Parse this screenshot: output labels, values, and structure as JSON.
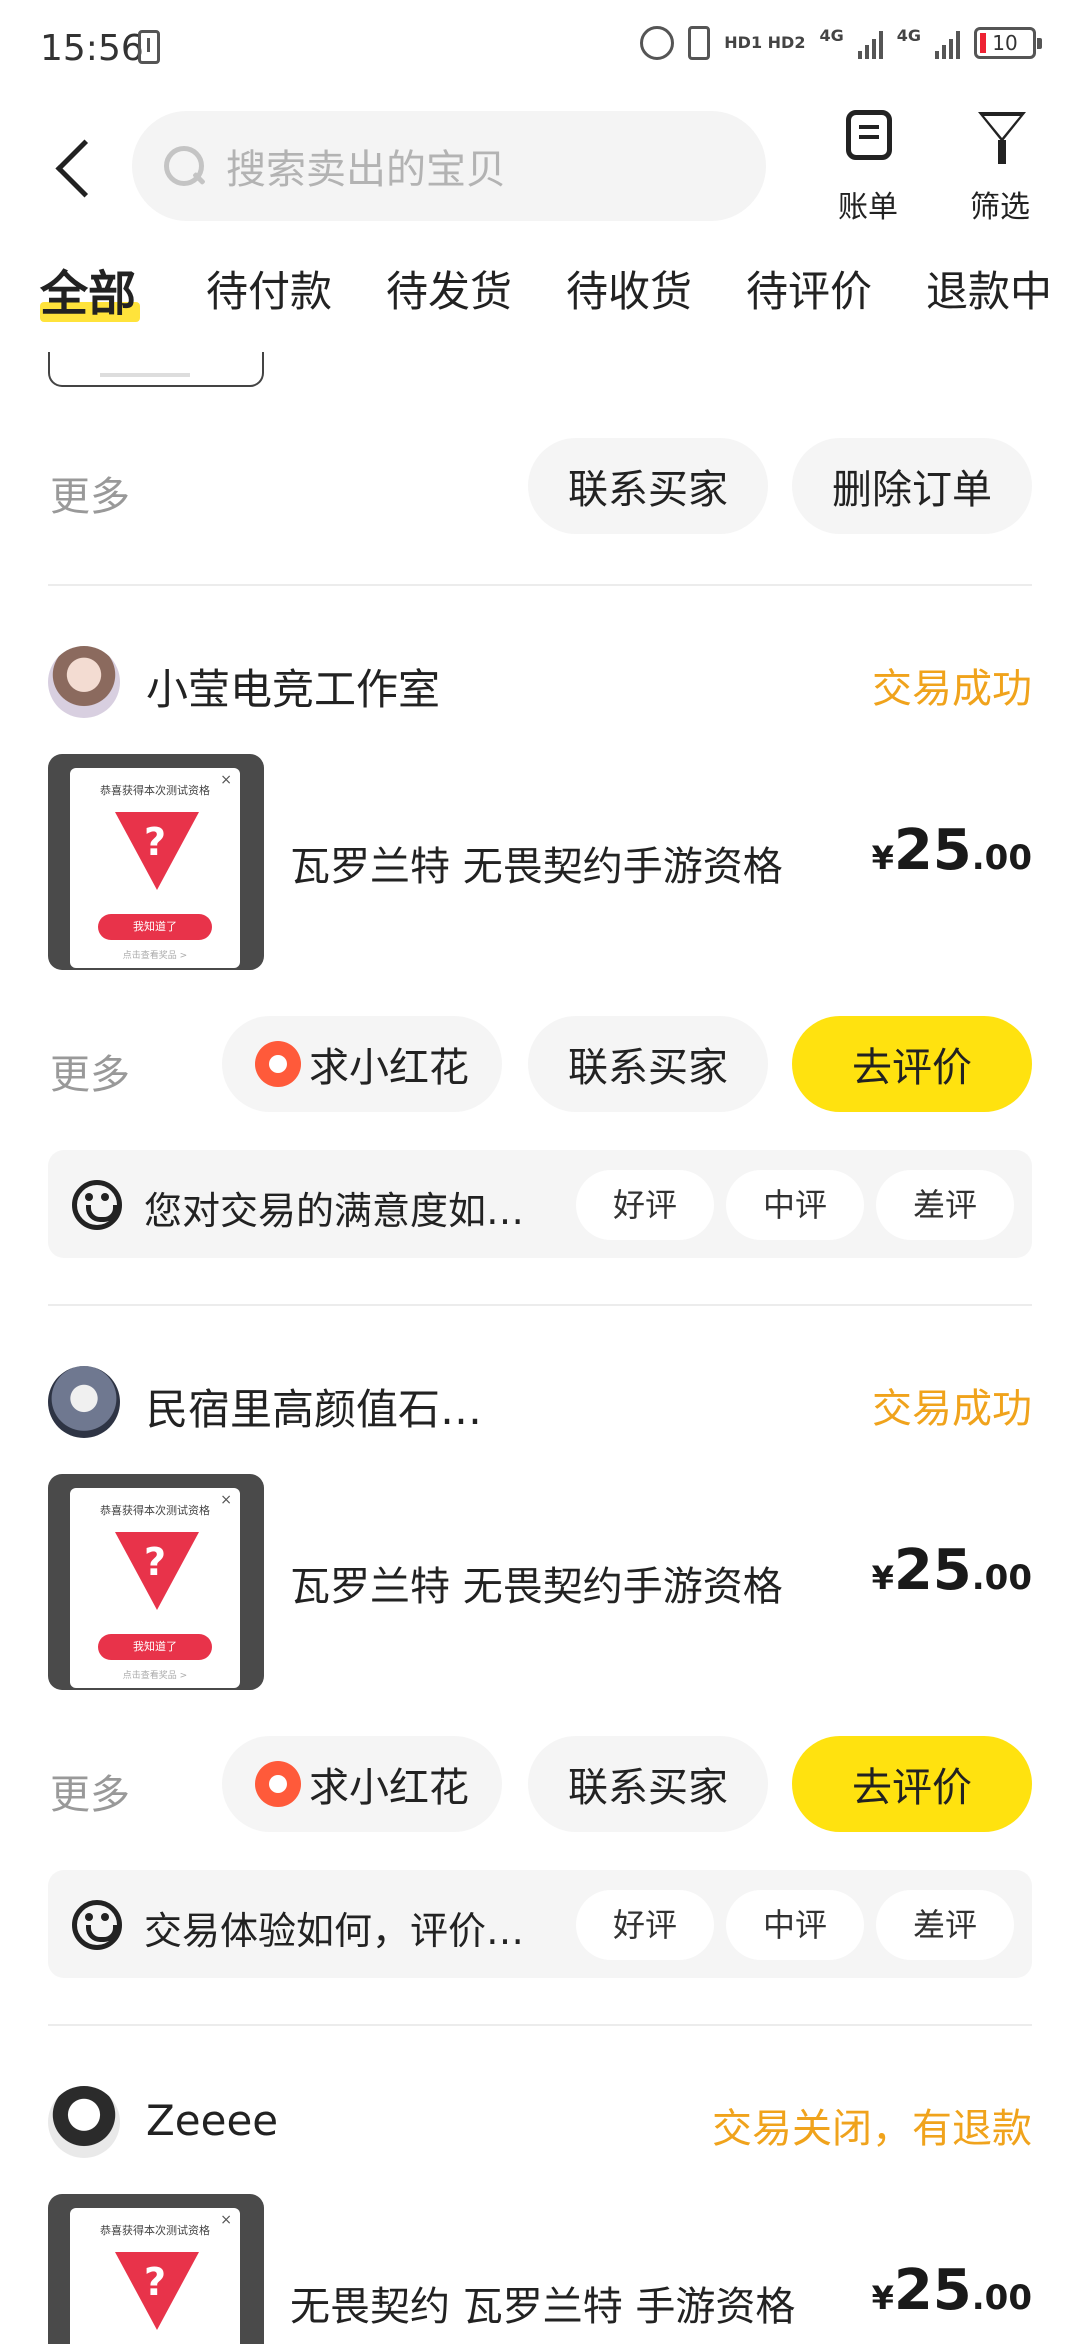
{
  "status_bar": {
    "time": "15:56",
    "hd": "HD1 HD2",
    "net1": "4G",
    "net2": "4G",
    "battery": "10"
  },
  "header": {
    "search_placeholder": "搜索卖出的宝贝",
    "bill_label": "账单",
    "filter_label": "筛选"
  },
  "tabs": [
    "全部",
    "待付款",
    "待发货",
    "待收货",
    "待评价",
    "退款中"
  ],
  "common": {
    "more": "更多",
    "contact_buyer": "联系买家",
    "delete_order": "删除订单",
    "ask_flower": "求小红花",
    "go_review": "去评价",
    "good": "好评",
    "neutral": "中评",
    "bad": "差评"
  },
  "thumb": {
    "title": "恭喜获得本次测试资格",
    "button": "我知道了",
    "link": "点击查看奖品 >",
    "mark": "?",
    "close": "×"
  },
  "orders": [
    {
      "seller": "小莹电竞工作室",
      "status": "交易成功",
      "item_name": "瓦罗兰特 无畏契约手游资格",
      "currency": "¥",
      "price_int": "25",
      "price_dec": ".00",
      "rating_question": "您对交易的满意度如…"
    },
    {
      "seller": "民宿里高颜值石…",
      "status": "交易成功",
      "item_name": "瓦罗兰特 无畏契约手游资格",
      "currency": "¥",
      "price_int": "25",
      "price_dec": ".00",
      "rating_question": "交易体验如何，评价…"
    },
    {
      "seller": "Zeeee",
      "status": "交易关闭，有退款",
      "item_name": "无畏契约 瓦罗兰特 手游资格",
      "currency": "¥",
      "price_int": "25",
      "price_dec": ".00"
    }
  ],
  "colors": {
    "accent_yellow": "#ffe20f",
    "status_orange": "#f0a31c",
    "flower_red": "#ff5a3a"
  }
}
